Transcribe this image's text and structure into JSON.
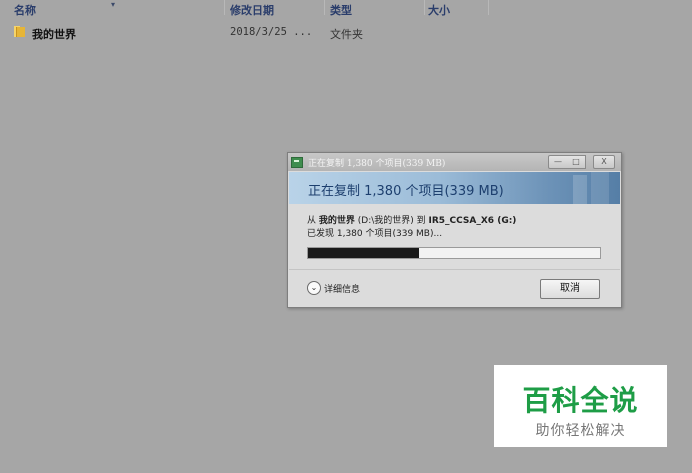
{
  "explorer": {
    "columns": {
      "name": "名称",
      "date": "修改日期",
      "type": "类型",
      "size": "大小"
    },
    "rows": [
      {
        "name": "我的世界",
        "date": "2018/3/25 ...",
        "type": "文件夹",
        "icon": "folder-icon"
      }
    ]
  },
  "dialog": {
    "title": "正在复制 1,380 个项目(339 MB)",
    "banner": "正在复制 1,380 个项目(339 MB)",
    "from_prefix": "从 ",
    "from_name": "我的世界",
    "from_path": " (D:\\我的世界) 到 ",
    "to_name": "IR5_CCSA_X6 (G:)",
    "found": "已发现 1,380 个项目(339 MB)...",
    "progress_fraction": 0.38,
    "details_label": "详细信息",
    "cancel_label": "取消",
    "window_buttons": {
      "minimize": "—",
      "maximize": "□",
      "close": "X"
    }
  },
  "watermark": {
    "title": "百科全说",
    "subtitle": "助你轻松解决"
  },
  "colors": {
    "desktop": "#a6a6a6",
    "banner_accent": "#557ea6",
    "watermark_green": "#1e9d46"
  }
}
